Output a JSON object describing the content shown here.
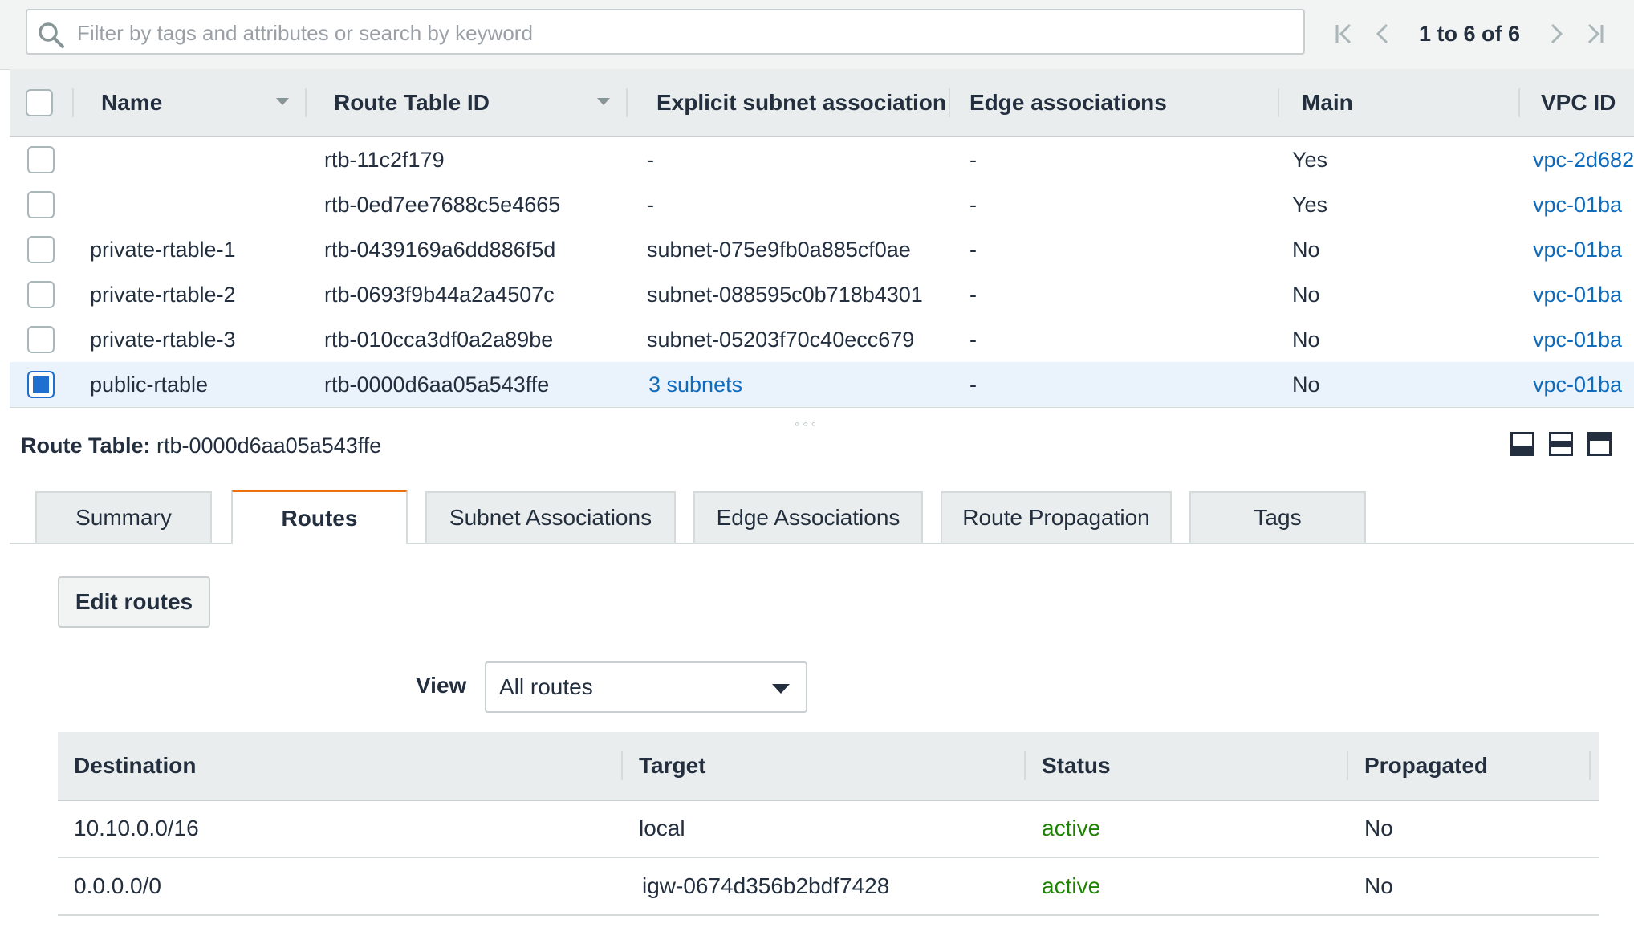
{
  "search": {
    "placeholder": "Filter by tags and attributes or search by keyword"
  },
  "pagination": {
    "text": "1 to 6 of 6"
  },
  "table": {
    "columns": [
      "Name",
      "Route Table ID",
      "Explicit subnet association",
      "Edge associations",
      "Main",
      "VPC ID"
    ],
    "rows": [
      {
        "name": "",
        "id": "rtb-11c2f179",
        "subnet": "-",
        "edge": "-",
        "main": "Yes",
        "vpc": "vpc-2d682",
        "selected": false
      },
      {
        "name": "",
        "id": "rtb-0ed7ee7688c5e4665",
        "subnet": "-",
        "edge": "-",
        "main": "Yes",
        "vpc": "vpc-01ba",
        "selected": false
      },
      {
        "name": "private-rtable-1",
        "id": "rtb-0439169a6dd886f5d",
        "subnet": "subnet-075e9fb0a885cf0ae",
        "edge": "-",
        "main": "No",
        "vpc": "vpc-01ba",
        "selected": false
      },
      {
        "name": "private-rtable-2",
        "id": "rtb-0693f9b44a2a4507c",
        "subnet": "subnet-088595c0b718b4301",
        "edge": "-",
        "main": "No",
        "vpc": "vpc-01ba",
        "selected": false
      },
      {
        "name": "private-rtable-3",
        "id": "rtb-010cca3df0a2a89be",
        "subnet": "subnet-05203f70c40ecc679",
        "edge": "-",
        "main": "No",
        "vpc": "vpc-01ba",
        "selected": false
      },
      {
        "name": "public-rtable",
        "id": "rtb-0000d6aa05a543ffe",
        "subnet": "3 subnets",
        "edge": "-",
        "main": "No",
        "vpc": "vpc-01ba",
        "selected": true
      }
    ]
  },
  "detail": {
    "label": "Route Table:",
    "value": "rtb-0000d6aa05a543ffe",
    "tabs": [
      "Summary",
      "Routes",
      "Subnet Associations",
      "Edge Associations",
      "Route Propagation",
      "Tags"
    ],
    "active_tab": "Routes",
    "edit_button": "Edit routes",
    "view_label": "View",
    "view_selected": "All routes"
  },
  "routes": {
    "columns": [
      "Destination",
      "Target",
      "Status",
      "Propagated"
    ],
    "rows": [
      {
        "destination": "10.10.0.0/16",
        "target": "local",
        "status": "active",
        "propagated": "No"
      },
      {
        "destination": "0.0.0.0/0",
        "target": "igw-0674d356b2bdf7428",
        "status": "active",
        "propagated": "No"
      }
    ]
  },
  "colors": {
    "link": "#0e6bbd",
    "active_status": "#1d8102",
    "tab_accent": "#ec7211",
    "selected_row": "#eaf2fb"
  }
}
